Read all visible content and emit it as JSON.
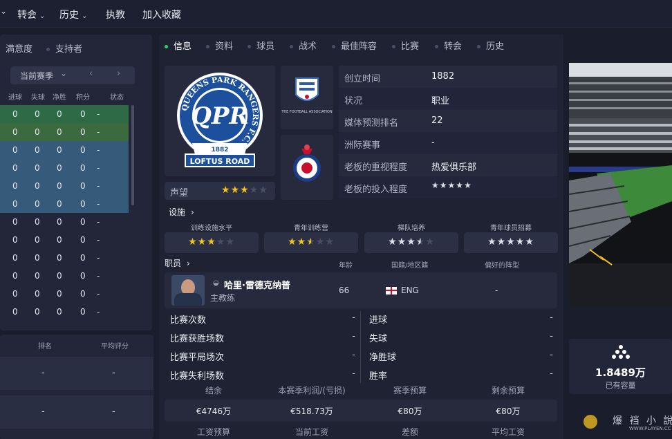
{
  "topbar": {
    "menus": [
      {
        "label": "转会",
        "has_chevron": true
      },
      {
        "label": "历史",
        "has_chevron": true
      },
      {
        "label": "执教",
        "has_chevron": false
      },
      {
        "label": "加入收藏",
        "has_chevron": false
      }
    ]
  },
  "left": {
    "tabs": [
      "满意度",
      "支持者"
    ],
    "season_select": "当前赛季",
    "columns": [
      "进球",
      "失球",
      "净胜",
      "积分",
      "状态"
    ],
    "rows": [
      [
        "0",
        "0",
        "0",
        "0",
        "-"
      ],
      [
        "0",
        "0",
        "0",
        "0",
        "-"
      ],
      [
        "0",
        "0",
        "0",
        "0",
        "-"
      ],
      [
        "0",
        "0",
        "0",
        "0",
        "-"
      ],
      [
        "0",
        "0",
        "0",
        "0",
        "-"
      ],
      [
        "0",
        "0",
        "0",
        "0",
        "-"
      ],
      [
        "0",
        "0",
        "0",
        "0",
        "-"
      ],
      [
        "0",
        "0",
        "0",
        "0",
        "-"
      ],
      [
        "0",
        "0",
        "0",
        "0",
        "-"
      ],
      [
        "0",
        "0",
        "0",
        "0",
        "-"
      ],
      [
        "0",
        "0",
        "0",
        "0",
        "-"
      ],
      [
        "0",
        "0",
        "0",
        "0",
        "-"
      ]
    ],
    "row_colors": [
      "#2e6a46",
      "#3a6a3e",
      "#365a7a",
      "#365a7a",
      "#365a7a",
      "#365a7a",
      "#232638",
      "#232638",
      "#232638",
      "#232638",
      "#232638",
      "#232638"
    ],
    "lower_headers": [
      "排名",
      "平均评分"
    ],
    "lower_rows": [
      [
        "-",
        "-"
      ],
      [
        "-",
        "-"
      ]
    ]
  },
  "center": {
    "tabs": [
      "信息",
      "资料",
      "球员",
      "战术",
      "最佳阵容",
      "比赛",
      "转会",
      "历史"
    ],
    "active_tab": 0,
    "crest": {
      "ring_text": "QUEENS PARK RANGERS F.C.",
      "year": "1882",
      "ground": "LOFTUS ROAD"
    },
    "fa_badge_text": "THE FOOTBALL ASSOCIATION",
    "reputation": {
      "label": "声望",
      "stars": 3,
      "max": 5
    },
    "info": [
      {
        "label": "创立时间",
        "value": "1882"
      },
      {
        "label": "状况",
        "value": "职业"
      },
      {
        "label": "媒体预测排名",
        "value": "22"
      },
      {
        "label": "洲际赛事",
        "value": "-"
      },
      {
        "label": "老板的重视程度",
        "value": "热爱俱乐部"
      },
      {
        "label": "老板的投入程度",
        "value": ""
      }
    ],
    "owner_investment_stars": 5,
    "facilities": {
      "title": "设施",
      "items": [
        {
          "label": "训练设施水平",
          "stars": 3,
          "max": 5
        },
        {
          "label": "青年训练营",
          "stars": 2.5,
          "max": 5
        },
        {
          "label": "梯队培养",
          "stars": 3.5,
          "max": 5
        },
        {
          "label": "青年球员招募",
          "stars": 5,
          "max": 5
        }
      ]
    },
    "staff": {
      "title": "职员",
      "columns": [
        "年龄",
        "国籍/地区籍",
        "偏好的阵型"
      ],
      "name": "哈里·雷德克纳普",
      "role": "主教练",
      "age": "66",
      "nation": "ENG",
      "formation": "-"
    },
    "stats_left": [
      {
        "label": "比赛次数",
        "value": "-"
      },
      {
        "label": "比赛获胜场数",
        "value": "-"
      },
      {
        "label": "比赛平局场次",
        "value": "-"
      },
      {
        "label": "比赛失利场数",
        "value": "-"
      }
    ],
    "stats_right": [
      {
        "label": "进球",
        "value": "-"
      },
      {
        "label": "失球",
        "value": "-"
      },
      {
        "label": "净胜球",
        "value": "-"
      },
      {
        "label": "胜率",
        "value": "-"
      }
    ],
    "finance": {
      "headers": [
        "结余",
        "本赛季利润/(亏损)",
        "赛季预算",
        "剩余预算"
      ],
      "values": [
        "€4746万",
        "€518.73万",
        "€80万",
        "€80万"
      ],
      "headers2": [
        "工资预算",
        "当前工资",
        "差额",
        "平均工资"
      ]
    }
  },
  "right": {
    "capacity_value": "1.8489万",
    "capacity_label": "已有容量",
    "watermark": "爆 裆 小 說",
    "watermark_url": "WWW.PLAYEN.CC"
  },
  "colors": {
    "accent_green": "#2fd36b",
    "star_gold": "#f3c420",
    "qpr_blue": "#1c4f9c"
  }
}
